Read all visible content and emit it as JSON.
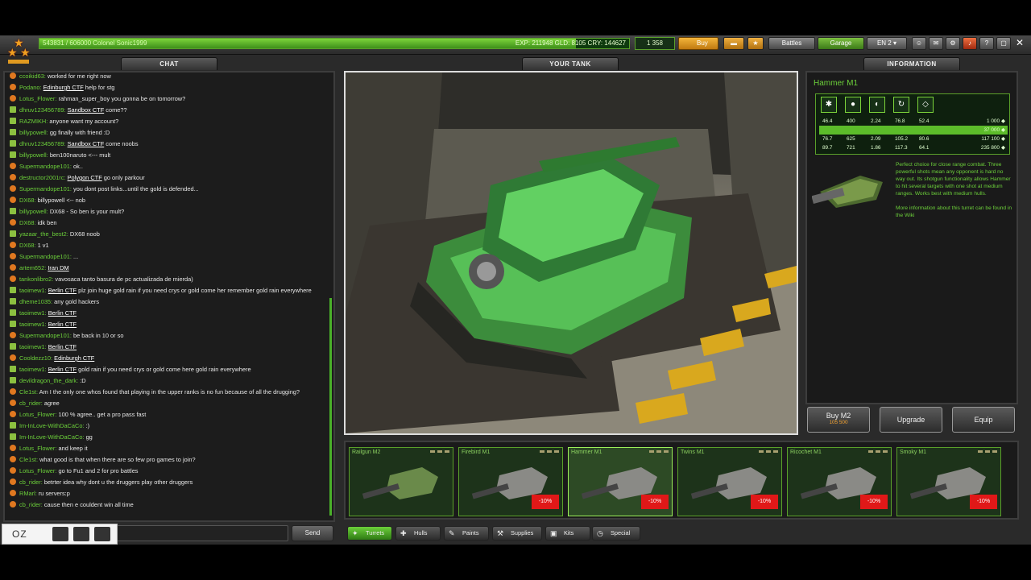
{
  "top": {
    "player_name": "543831 / 606000   Colonel Sonic1999",
    "stats": "EXP: 211948 GLD: 8105 CRY: 144627",
    "xp_progress": 0.91,
    "crystals": "1 358",
    "buy_label": "Buy",
    "battles_label": "Battles",
    "garage_label": "Garage",
    "lang_label": "EN 2"
  },
  "panels": {
    "chat": "CHAT",
    "tank": "YOUR TANK",
    "info": "INFORMATION"
  },
  "chat": {
    "send_label": "Send",
    "logo_text": "OZ",
    "messages": [
      {
        "nick": "ccoikid63:",
        "text": "worked for me right now",
        "icon": "orange"
      },
      {
        "nick": "Podano:",
        "link": "Edinburgh CTF",
        "text": "help for stg",
        "icon": "orange"
      },
      {
        "nick": "Lotus_Flower:",
        "text": "rahman_super_boy you gonna be on tomorrow?",
        "icon": "orange"
      },
      {
        "nick": "dhruv123456789:",
        "link": "Sandbox CTF",
        "text": "come??",
        "icon": "green"
      },
      {
        "nick": "RAZMIKH:",
        "text": "anyone want my account?",
        "icon": "green"
      },
      {
        "nick": "billypowell:",
        "text": "gg finally with friend :D",
        "icon": "green"
      },
      {
        "nick": "dhruv123456789:",
        "link": "Sandbox CTF",
        "text": "come noobs",
        "icon": "green"
      },
      {
        "nick": "billypowell:",
        "text": "ben100naruto <--- mult",
        "icon": "green"
      },
      {
        "nick": "Supermandope101:",
        "text": "ok..",
        "icon": "orange"
      },
      {
        "nick": "destructor2001rc:",
        "link": "Polygon CTF",
        "text": "go only parkour",
        "icon": "orange"
      },
      {
        "nick": "Supermandope101:",
        "text": "you dont post links...until the gold is defended...",
        "icon": "orange"
      },
      {
        "nick": "DX68:",
        "text": "billypowell <-- nob",
        "icon": "orange"
      },
      {
        "nick": "billypowell:",
        "text": "DX68 - So ben is your mult?",
        "icon": "green"
      },
      {
        "nick": "DX68:",
        "text": "idk ben",
        "icon": "orange"
      },
      {
        "nick": "yazaar_the_best2:",
        "text": "DX68 noob",
        "icon": "green"
      },
      {
        "nick": "DX68:",
        "text": "1 v1",
        "icon": "orange"
      },
      {
        "nick": "Supermandope101:",
        "text": "...",
        "icon": "orange"
      },
      {
        "nick": "artem652:",
        "link": "Iran DM",
        "text": "",
        "icon": "orange"
      },
      {
        "nick": "tankonlibro2:",
        "text": "vavosaca tanto basura de pc actualizada de mierda)",
        "icon": "orange"
      },
      {
        "nick": "taoimew1:",
        "link": "Berlin CTF",
        "text": "plz join huge gold rain if you need crys or gold come her remember gold rain everywhere",
        "icon": "green"
      },
      {
        "nick": "dheme1035:",
        "text": "any gold hackers",
        "icon": "green"
      },
      {
        "nick": "taoimew1:",
        "link": "Berlin CTF",
        "text": "",
        "icon": "green"
      },
      {
        "nick": "taoimew1:",
        "link": "Berlin CTF",
        "text": "",
        "icon": "green"
      },
      {
        "nick": "Supermandope101:",
        "text": "be back in 10 or so",
        "icon": "orange"
      },
      {
        "nick": "taoimew1:",
        "link": "Berlin CTF",
        "text": "",
        "icon": "green"
      },
      {
        "nick": "Cooldezz10:",
        "link": "Edinburgh CTF",
        "text": "",
        "icon": "orange"
      },
      {
        "nick": "taoimew1:",
        "link": "Berlin CTF",
        "text": "gold rain if you need crys or gold come here gold rain everywhere",
        "icon": "green"
      },
      {
        "nick": "devildragon_the_dark:",
        "text": ":D",
        "icon": "green"
      },
      {
        "nick": "Cle1st:",
        "text": "Am I the only one whos found that playing in the upper ranks is no fun because of all the drugging?",
        "icon": "orange"
      },
      {
        "nick": "cb_rider:",
        "text": "agree",
        "icon": "orange"
      },
      {
        "nick": "Lotus_Flower:",
        "text": "100 % agree.. get a pro pass fast",
        "icon": "orange"
      },
      {
        "nick": "Im-InLove-WithDaCaCo:",
        "text": ":)",
        "icon": "green"
      },
      {
        "nick": "Im-InLove-WithDaCaCo:",
        "text": "gg",
        "icon": "green"
      },
      {
        "nick": "Lotus_Flower:",
        "text": "and keep it",
        "icon": "orange"
      },
      {
        "nick": "Cle1st:",
        "text": "what good is that when there are so few pro games to join?",
        "icon": "orange"
      },
      {
        "nick": "Lotus_Flower:",
        "text": "go to Fu1 and 2 for pro battles",
        "icon": "orange"
      },
      {
        "nick": "cb_rider:",
        "text": "betrter idea why dont u the druggers play other druggers",
        "icon": "orange"
      },
      {
        "nick": "RMarl:",
        "text": "ru servers:p",
        "icon": "orange"
      },
      {
        "nick": "cb_rider:",
        "text": "cause then e couldent win all time",
        "icon": "orange"
      }
    ]
  },
  "info": {
    "title": "Hammer M1",
    "stat_rows": [
      {
        "a": "46.4",
        "b": "400",
        "c": "2.24",
        "d": "76.8",
        "e": "52.4",
        "price": "1 000",
        "selected": false
      },
      {
        "a": "",
        "b": "",
        "c": "",
        "d": "",
        "e": "",
        "price": "37 000",
        "selected": true
      },
      {
        "a": "76.7",
        "b": "625",
        "c": "2.09",
        "d": "105.2",
        "e": "80.6",
        "price": "117 100",
        "selected": false
      },
      {
        "a": "89.7",
        "b": "721",
        "c": "1.86",
        "d": "117.3",
        "e": "64.1",
        "price": "235 800",
        "selected": false
      }
    ],
    "desc1": "Perfect choice for close range combat. Three powerful shots mean any opponent is hard no way out. Its shotgun functionality allows Hammer to hit several targets with one shot at medium ranges. Works best with medium hulls.",
    "desc2": "More information about this turret can be found in the Wiki",
    "buy_label": "Buy M2",
    "buy_price": "105 500",
    "upgrade_label": "Upgrade",
    "equip_label": "Equip"
  },
  "items": [
    {
      "name": "Railgun M2",
      "discount": "",
      "selected": false
    },
    {
      "name": "Firebird M1",
      "discount": "-10%",
      "selected": false
    },
    {
      "name": "Hammer M1",
      "discount": "-10%",
      "selected": true
    },
    {
      "name": "Twins M1",
      "discount": "-10%",
      "selected": false
    },
    {
      "name": "Ricochet M1",
      "discount": "-10%",
      "selected": false
    },
    {
      "name": "Smoky M1",
      "discount": "-10%",
      "selected": false
    }
  ],
  "tabs": [
    "Turrets",
    "Hulls",
    "Paints",
    "Supplies",
    "Kits",
    "Special"
  ]
}
